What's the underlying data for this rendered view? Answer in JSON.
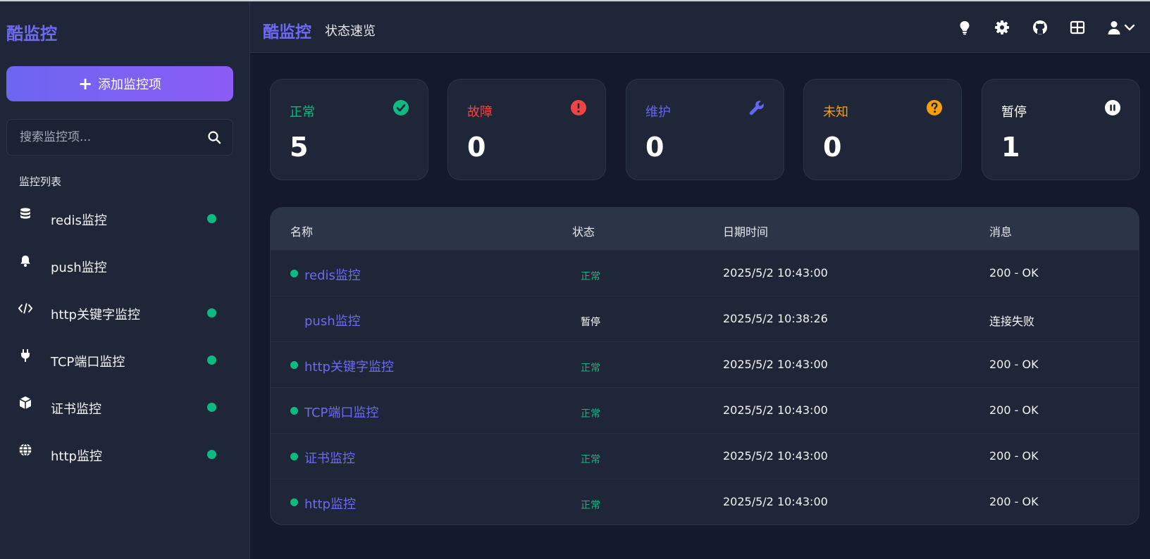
{
  "app": {
    "brand": "酷监控"
  },
  "header": {
    "brand": "酷监控",
    "subtitle": "状态速览",
    "icons": [
      "lightbulb-icon",
      "gear-icon",
      "github-icon",
      "grid-icon",
      "user-icon",
      "chevron-down-icon"
    ]
  },
  "sidebar": {
    "add_label": "添加监控项",
    "search_placeholder": "搜索监控项...",
    "section_label": "监控列表",
    "items": [
      {
        "label": "redis监控",
        "icon": "database-icon",
        "status_dot": true
      },
      {
        "label": "push监控",
        "icon": "bell-icon",
        "status_dot": false
      },
      {
        "label": "http关键字监控",
        "icon": "code-icon",
        "status_dot": true
      },
      {
        "label": "TCP端口监控",
        "icon": "plug-icon",
        "status_dot": true
      },
      {
        "label": "证书监控",
        "icon": "cube-icon",
        "status_dot": true
      },
      {
        "label": "http监控",
        "icon": "globe-icon",
        "status_dot": true
      }
    ]
  },
  "stats": [
    {
      "label": "正常",
      "value": "5",
      "color": "#10b981",
      "icon": "check-circle-icon"
    },
    {
      "label": "故障",
      "value": "0",
      "color": "#ef4444",
      "icon": "exclamation-circle-icon"
    },
    {
      "label": "维护",
      "value": "0",
      "color": "#6366f1",
      "icon": "wrench-icon"
    },
    {
      "label": "未知",
      "value": "0",
      "color": "#f59e0b",
      "icon": "question-circle-icon"
    },
    {
      "label": "暂停",
      "value": "1",
      "color": "#ffffff",
      "icon": "pause-circle-icon"
    }
  ],
  "table": {
    "headers": [
      "名称",
      "状态",
      "日期时间",
      "消息"
    ],
    "rows": [
      {
        "name": "redis监控",
        "status": "正常",
        "status_color": "#10b981",
        "dot": true,
        "time": "2025/5/2 10:43:00",
        "message": "200 - OK"
      },
      {
        "name": "push监控",
        "status": "暂停",
        "status_color": "#ffffff",
        "dot": false,
        "time": "2025/5/2 10:38:26",
        "message": "连接失败"
      },
      {
        "name": "http关键字监控",
        "status": "正常",
        "status_color": "#10b981",
        "dot": true,
        "time": "2025/5/2 10:43:00",
        "message": "200 - OK"
      },
      {
        "name": "TCP端口监控",
        "status": "正常",
        "status_color": "#10b981",
        "dot": true,
        "time": "2025/5/2 10:43:00",
        "message": "200 - OK"
      },
      {
        "name": "证书监控",
        "status": "正常",
        "status_color": "#10b981",
        "dot": true,
        "time": "2025/5/2 10:43:00",
        "message": "200 - OK"
      },
      {
        "name": "http监控",
        "status": "正常",
        "status_color": "#10b981",
        "dot": true,
        "time": "2025/5/2 10:43:00",
        "message": "200 - OK"
      }
    ]
  }
}
